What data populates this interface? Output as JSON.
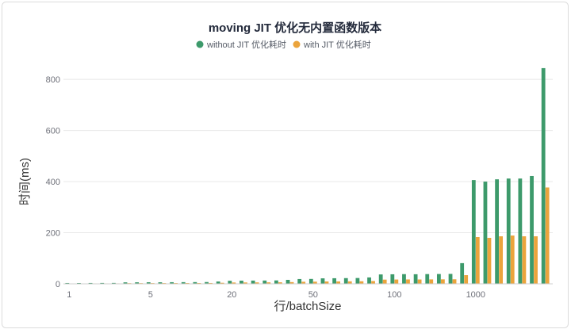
{
  "chart_data": {
    "type": "bar",
    "title": "moving JIT 优化无内置函数版本",
    "xlabel": "行/batchSize",
    "ylabel": "时间(ms)",
    "ylim": [
      0,
      850
    ],
    "yticks": [
      0,
      200,
      400,
      600,
      800
    ],
    "grid": true,
    "legend_position": "top",
    "categories": [
      "1",
      "",
      "",
      "",
      "",
      "",
      "",
      "5",
      "",
      "",
      "",
      "",
      "",
      "",
      "20",
      "",
      "",
      "",
      "",
      "",
      "",
      "50",
      "",
      "",
      "",
      "",
      "",
      "",
      "100",
      "",
      "",
      "",
      "",
      "",
      "",
      "1000",
      "",
      "",
      "",
      "",
      "",
      ""
    ],
    "series": [
      {
        "name": "without JIT 优化耗时",
        "color": "#3d9a6b",
        "values": [
          3.2,
          3.1,
          3.3,
          3.4,
          3.5,
          5.8,
          6.0,
          6.2,
          6.1,
          6.4,
          6.6,
          6.8,
          7.0,
          9.2,
          12.1,
          12.5,
          12.8,
          13.0,
          13.4,
          15.6,
          18.8,
          19.2,
          21.5,
          22.0,
          22.4,
          22.8,
          25.1,
          36.8,
          37.4,
          38.0,
          37.6,
          38.2,
          38.5,
          38.9,
          81.0,
          406,
          400,
          409,
          412,
          412,
          422,
          844
        ]
      },
      {
        "name": "with JIT 优化耗时",
        "color": "#eba43c",
        "values": [
          1.5,
          1.5,
          1.6,
          1.6,
          1.7,
          2.5,
          2.6,
          2.7,
          2.8,
          2.9,
          3.0,
          3.1,
          3.2,
          4.0,
          5.2,
          5.4,
          5.6,
          5.8,
          6.0,
          6.8,
          8.2,
          8.5,
          9.3,
          9.6,
          9.8,
          10.1,
          11.0,
          16.5,
          16.9,
          17.2,
          17.0,
          17.4,
          17.6,
          17.8,
          34.0,
          183,
          180,
          186,
          189,
          186,
          186,
          377
        ]
      }
    ]
  }
}
